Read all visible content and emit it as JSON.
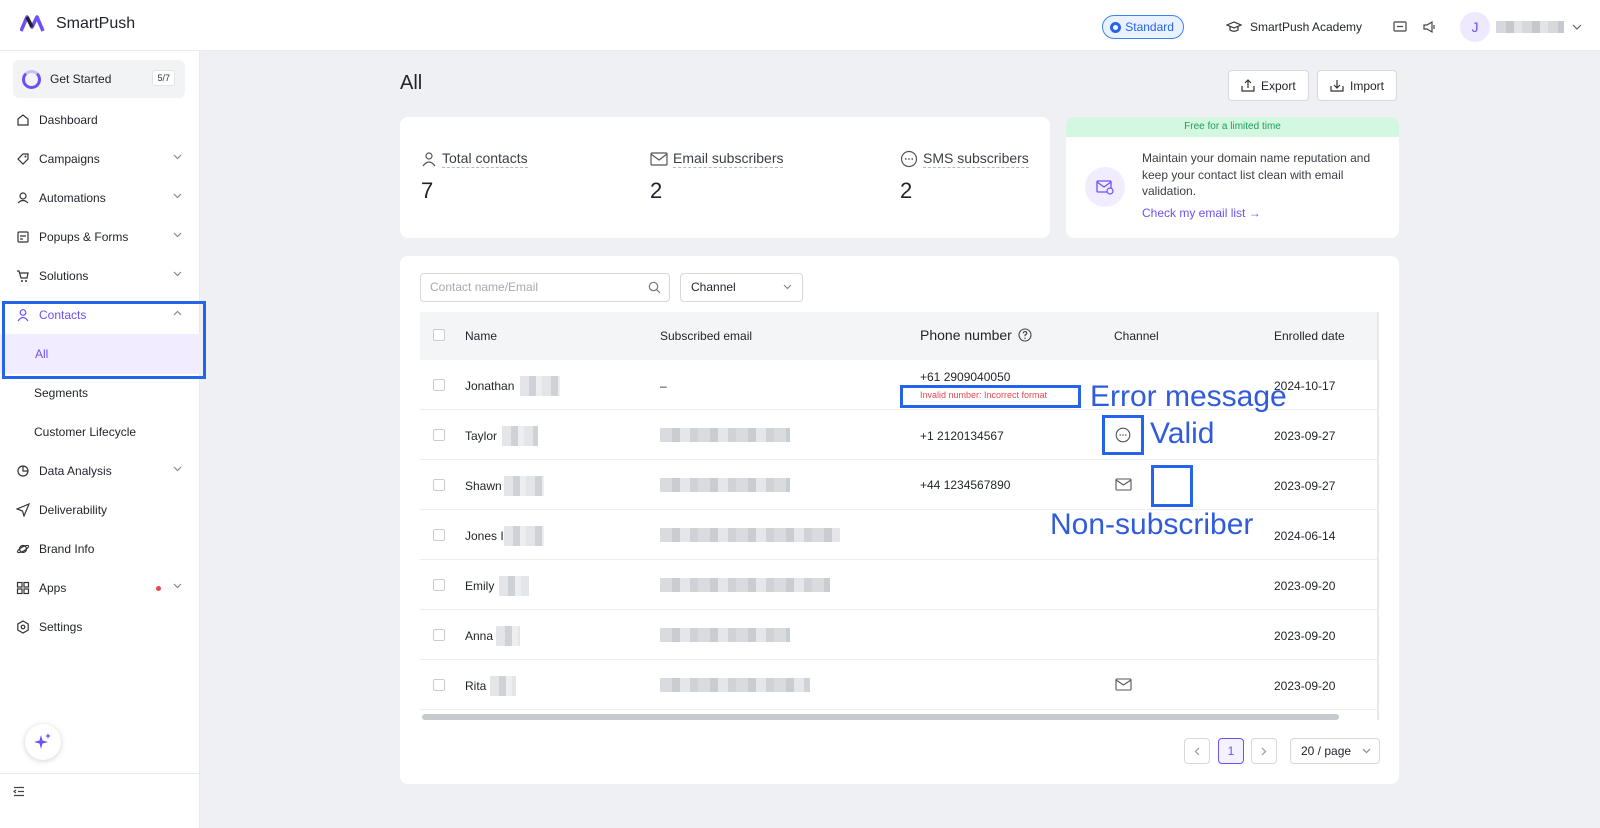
{
  "app": {
    "name": "SmartPush"
  },
  "header": {
    "plan_badge": "Standard",
    "academy_label": "SmartPush Academy",
    "user_initial": "J"
  },
  "sidebar": {
    "get_started": {
      "label": "Get Started",
      "progress": "5/7"
    },
    "items": [
      {
        "label": "Dashboard",
        "icon": "home-icon"
      },
      {
        "label": "Campaigns",
        "icon": "tag-icon"
      },
      {
        "label": "Automations",
        "icon": "automation-icon"
      },
      {
        "label": "Popups & Forms",
        "icon": "form-icon"
      },
      {
        "label": "Solutions",
        "icon": "cart-icon"
      },
      {
        "label": "Contacts",
        "icon": "user-icon"
      },
      {
        "label": "Data Analysis",
        "icon": "pie-chart-icon"
      },
      {
        "label": "Deliverability",
        "icon": "send-icon"
      },
      {
        "label": "Brand Info",
        "icon": "planet-icon"
      },
      {
        "label": "Apps",
        "icon": "apps-icon"
      },
      {
        "label": "Settings",
        "icon": "settings-icon"
      }
    ],
    "contacts_sub": [
      "All",
      "Segments",
      "Customer Lifecycle"
    ]
  },
  "page": {
    "title": "All",
    "export_label": "Export",
    "import_label": "Import"
  },
  "stats": [
    {
      "label": "Total contacts",
      "value": "7"
    },
    {
      "label": "Email subscribers",
      "value": "2"
    },
    {
      "label": "SMS subscribers",
      "value": "2"
    }
  ],
  "promo": {
    "banner": "Free for a limited time",
    "text": "Maintain your domain name reputation and keep your contact list clean with email validation.",
    "link": "Check my email list →"
  },
  "filters": {
    "search_placeholder": "Contact name/Email",
    "channel_label": "Channel"
  },
  "table": {
    "columns": [
      "Name",
      "Subscribed email",
      "Phone number",
      "Channel",
      "Enrolled date"
    ],
    "rows": [
      {
        "name": "Jonathan",
        "email": "–",
        "phone": "+61 2909040050",
        "error": "Invalid number: Incorrect format",
        "channel": "",
        "date": "2024-10-17"
      },
      {
        "name": "Taylor",
        "email": "",
        "phone": "+1 2120134567",
        "channel": "sms",
        "date": "2023-09-27"
      },
      {
        "name": "Shawn",
        "email": "",
        "phone": "+44 1234567890",
        "channel": "email",
        "date": "2023-09-27"
      },
      {
        "name": "Jones I",
        "email": "",
        "phone": "",
        "channel": "",
        "date": "2024-06-14"
      },
      {
        "name": "Emily",
        "email": "",
        "phone": "",
        "channel": "",
        "date": "2023-09-20"
      },
      {
        "name": "Anna",
        "email": "",
        "phone": "",
        "channel": "",
        "date": "2023-09-20"
      },
      {
        "name": "Rita",
        "email": "",
        "phone": "",
        "channel": "email",
        "date": "2023-09-20"
      }
    ]
  },
  "pagination": {
    "current_page": "1",
    "page_size": "20 / page"
  },
  "annotations": {
    "error_message": "Error message",
    "valid": "Valid",
    "non_subscriber": "Non-subscriber"
  },
  "colors": {
    "accent": "#6e4ff5",
    "annotation": "#2563eb",
    "error": "#e5484d"
  }
}
